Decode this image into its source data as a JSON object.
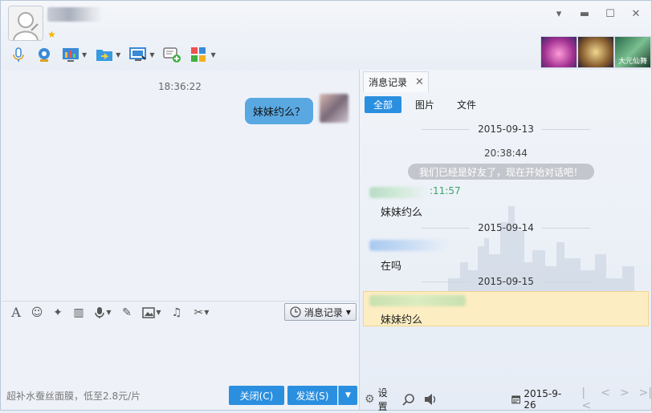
{
  "window": {
    "controls": {
      "dropdown": "▾",
      "minimize": "▬",
      "maximize": "☐",
      "close": "✕"
    }
  },
  "chat": {
    "time": "18:36:22",
    "bubble": "妹妹约么？"
  },
  "input_toolbar": {
    "history_label": "消息记录"
  },
  "bottom": {
    "ad": "超补水蚕丝面膜，低至2.8元/片",
    "close_label": "关闭(C)",
    "send_label": "发送(S)"
  },
  "history": {
    "tab_label": "消息记录",
    "filters": [
      "全部",
      "图片",
      "文件"
    ],
    "entries": {
      "date1": "2015-09-13",
      "sys_time": "20:38:44",
      "sys_msg": "我们已经是好友了，现在开始对话吧！",
      "msg1_time": ":11:57",
      "msg1_text": "妹妹约么",
      "date2": "2015-09-14",
      "msg2_text": "在吗",
      "date3": "2015-09-15",
      "msg3_text": "妹妹约么"
    },
    "bottom": {
      "settings_label": "设置",
      "date": "2015-9-26"
    }
  },
  "games": {
    "g3_label": "大元仙舞"
  }
}
